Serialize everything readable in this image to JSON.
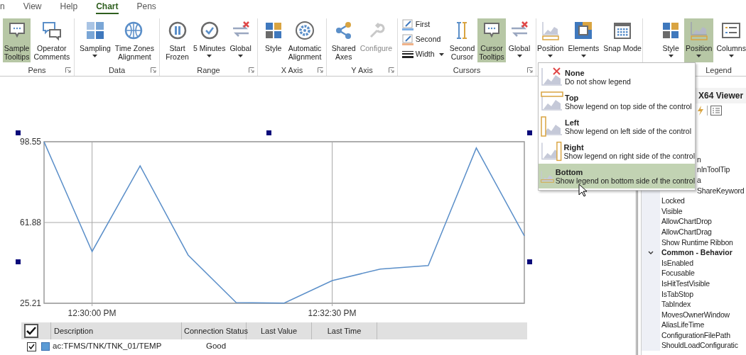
{
  "menu_tabs": [
    {
      "label": "n",
      "selected": false
    },
    {
      "label": "View",
      "selected": false
    },
    {
      "label": "Help",
      "selected": false
    },
    {
      "label": "Chart",
      "selected": true
    },
    {
      "label": "Pens",
      "selected": false
    }
  ],
  "ribbon_groups": [
    {
      "label": "Pens",
      "launcher": true,
      "items": [
        {
          "kind": "large",
          "label": "Sample\nTooltips",
          "selected": true,
          "dropdown": false,
          "disabled": false
        },
        {
          "kind": "large",
          "label": "Operator\nComments",
          "selected": false,
          "dropdown": false,
          "disabled": false
        }
      ]
    },
    {
      "label": "Data",
      "launcher": true,
      "items": [
        {
          "kind": "large",
          "label": "Sampling",
          "selected": false,
          "dropdown": true,
          "disabled": false
        },
        {
          "kind": "large",
          "label": "Time Zones\nAlignment",
          "selected": false,
          "dropdown": false,
          "disabled": false
        }
      ]
    },
    {
      "label": "Range",
      "launcher": true,
      "items": [
        {
          "kind": "large",
          "label": "Start\nFrozen",
          "selected": false,
          "dropdown": false,
          "disabled": false
        },
        {
          "kind": "large",
          "label": "5 Minutes",
          "selected": false,
          "dropdown": true,
          "disabled": false
        },
        {
          "kind": "large",
          "label": "Global",
          "selected": false,
          "dropdown": true,
          "disabled": false
        }
      ]
    },
    {
      "label": "X Axis",
      "launcher": true,
      "items": [
        {
          "kind": "large",
          "label": "Style",
          "selected": false,
          "dropdown": false,
          "disabled": false
        },
        {
          "kind": "large",
          "label": "Automatic\nAlignment",
          "selected": false,
          "dropdown": false,
          "disabled": false
        }
      ]
    },
    {
      "label": "Y Axis",
      "launcher": true,
      "items": [
        {
          "kind": "large",
          "label": "Shared\nAxes",
          "selected": false,
          "dropdown": false,
          "disabled": false
        },
        {
          "kind": "large",
          "label": "Configure",
          "selected": false,
          "dropdown": false,
          "disabled": true
        }
      ]
    },
    {
      "label": "Cursors",
      "launcher": true,
      "items": [
        {
          "kind": "stack",
          "entries": [
            {
              "label": "First",
              "dropdown": false
            },
            {
              "label": "Second",
              "dropdown": false
            },
            {
              "label": "Width",
              "dropdown": true
            }
          ]
        },
        {
          "kind": "large",
          "label": "Second\nCursor",
          "selected": false,
          "dropdown": false,
          "disabled": false
        },
        {
          "kind": "large",
          "label": "Cursor\nTooltips",
          "selected": true,
          "dropdown": false,
          "disabled": false
        },
        {
          "kind": "large",
          "label": "Global",
          "selected": false,
          "dropdown": true,
          "disabled": false
        }
      ]
    },
    {
      "launcher": false,
      "items": [
        {
          "kind": "large",
          "label": "Position",
          "selected": false,
          "dropdown": true,
          "disabled": false
        },
        {
          "kind": "large",
          "label": "Elements",
          "selected": false,
          "dropdown": true,
          "disabled": false
        },
        {
          "kind": "large",
          "label": "Snap Mode",
          "selected": false,
          "dropdown": false,
          "disabled": false
        }
      ]
    },
    {
      "label": "Legend",
      "launcher": false,
      "items": [
        {
          "kind": "large",
          "label": "Style",
          "selected": false,
          "dropdown": true,
          "disabled": false
        },
        {
          "kind": "large",
          "label": "Position",
          "selected": true,
          "dropdown": true,
          "disabled": false
        },
        {
          "kind": "large",
          "label": "Columns",
          "selected": false,
          "dropdown": true,
          "disabled": false
        }
      ]
    }
  ],
  "legend_position_menu": {
    "items": [
      {
        "title": "None",
        "description": "Do not show legend",
        "selected": false
      },
      {
        "title": "Top",
        "description": "Show legend on top side of the control",
        "selected": false
      },
      {
        "title": "Left",
        "description": "Show legend on left side of the control",
        "selected": false
      },
      {
        "title": "Right",
        "description": "Show legend on right side of the control",
        "selected": false
      },
      {
        "title": "Bottom",
        "description": "Show legend on bottom side of the control",
        "selected": true
      }
    ]
  },
  "chart": {
    "chart_data": {
      "type": "line",
      "grid": true,
      "categories": [
        null,
        "12:30:00 PM",
        null,
        null,
        null,
        null,
        "12:32:30 PM",
        null,
        null,
        null,
        null
      ],
      "ylim": [
        25.21,
        98.55
      ],
      "yticks": [
        {
          "value": 98.55,
          "label": "98.55"
        },
        {
          "value": 61.88,
          "label": "61.88"
        },
        {
          "value": 25.21,
          "label": "25.21"
        }
      ],
      "series": [
        {
          "color": "#5b8fc9",
          "values": [
            98.5,
            48.7,
            87.6,
            47.1,
            25.5,
            25.3,
            35.5,
            40.7,
            42.3,
            95.7,
            55.8
          ]
        }
      ]
    }
  },
  "legend_grid": {
    "all_checked": true,
    "columns": [
      "Description",
      "Connection Status",
      "Last Value",
      "Last Time"
    ],
    "rows": [
      {
        "checked": true,
        "color": "#5b9bd5",
        "description": "ac:TFMS/TNK/TNK_01/TEMP",
        "connection_status": "Good"
      }
    ]
  },
  "properties": {
    "title": "X64 Viewer",
    "items": [
      {
        "kind": "property",
        "name": "n"
      },
      {
        "kind": "property",
        "name": "nInToolTip"
      },
      {
        "kind": "property",
        "name": "a"
      },
      {
        "kind": "property",
        "name": "ShareKeyword"
      },
      {
        "kind": "property",
        "name": "Locked"
      },
      {
        "kind": "property",
        "name": "Visible"
      },
      {
        "kind": "property",
        "name": "AllowChartDrop"
      },
      {
        "kind": "property",
        "name": "AllowChartDrag"
      },
      {
        "kind": "property",
        "name": "Show Runtime Ribbon"
      },
      {
        "kind": "category",
        "name": "Common - Behavior",
        "expanded": true
      },
      {
        "kind": "property",
        "name": "IsEnabled"
      },
      {
        "kind": "property",
        "name": "Focusable"
      },
      {
        "kind": "property",
        "name": "IsHitTestVisible"
      },
      {
        "kind": "property",
        "name": "IsTabStop"
      },
      {
        "kind": "property",
        "name": "TabIndex"
      },
      {
        "kind": "property",
        "name": "MovesOwnerWindow"
      },
      {
        "kind": "property",
        "name": "AliasLifeTime"
      },
      {
        "kind": "property",
        "name": "ConfigurationFilePath"
      },
      {
        "kind": "property",
        "name": "ShouldLoadConfiguratic"
      }
    ]
  }
}
